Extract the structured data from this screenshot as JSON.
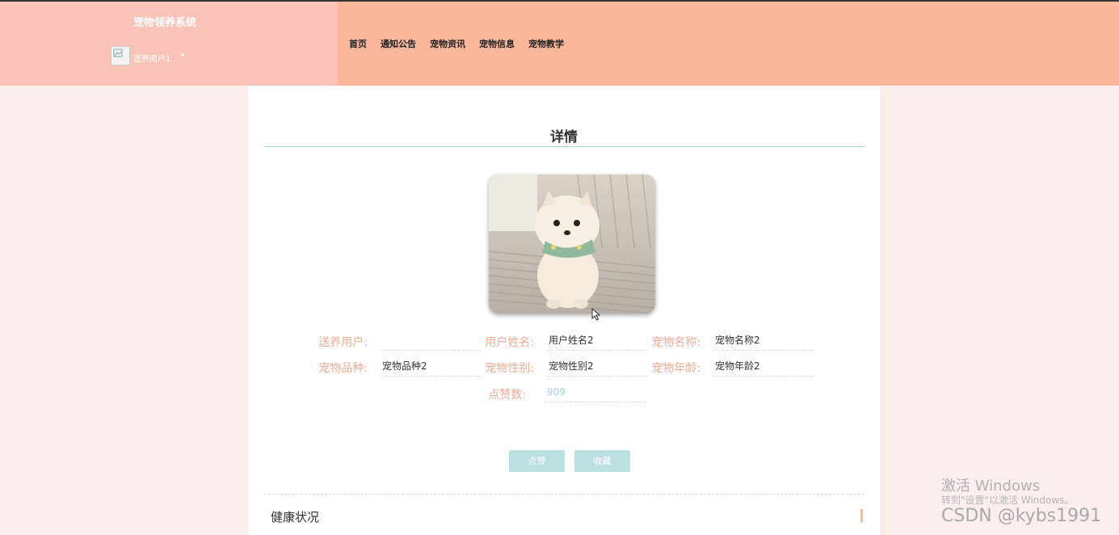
{
  "header": {
    "site_title": "宠物领养系统",
    "user_name": "送养用户1",
    "user_caret": "▾",
    "nav": [
      "首页",
      "通知公告",
      "宠物资讯",
      "宠物信息",
      "宠物教学"
    ]
  },
  "detail": {
    "title": "详情",
    "fields": [
      {
        "label": "送养用户:",
        "value": ""
      },
      {
        "label": "用户姓名:",
        "value": "用户姓名2"
      },
      {
        "label": "宠物名称:",
        "value": "宠物名称2"
      },
      {
        "label": "宠物品种:",
        "value": "宠物品种2"
      },
      {
        "label": "宠物性别:",
        "value": "宠物性别2"
      },
      {
        "label": "宠物年龄:",
        "value": "宠物年龄2"
      },
      {
        "label": "点赞数:",
        "value": "909"
      }
    ],
    "like_button": "点赞",
    "favorite_button": "收藏",
    "section_title": "健康状况"
  },
  "watermark": {
    "activate": "激活 Windows",
    "goto_settings": "转到\"设置\"以激活 Windows。",
    "csdn": "CSDN @kybs1991"
  },
  "colors": {
    "header_left": "#f9c3b7",
    "header_right": "#fbb79b",
    "label": "#f0ad95",
    "button": "#bcdfe2",
    "accent_line": "#a8d2d9"
  }
}
